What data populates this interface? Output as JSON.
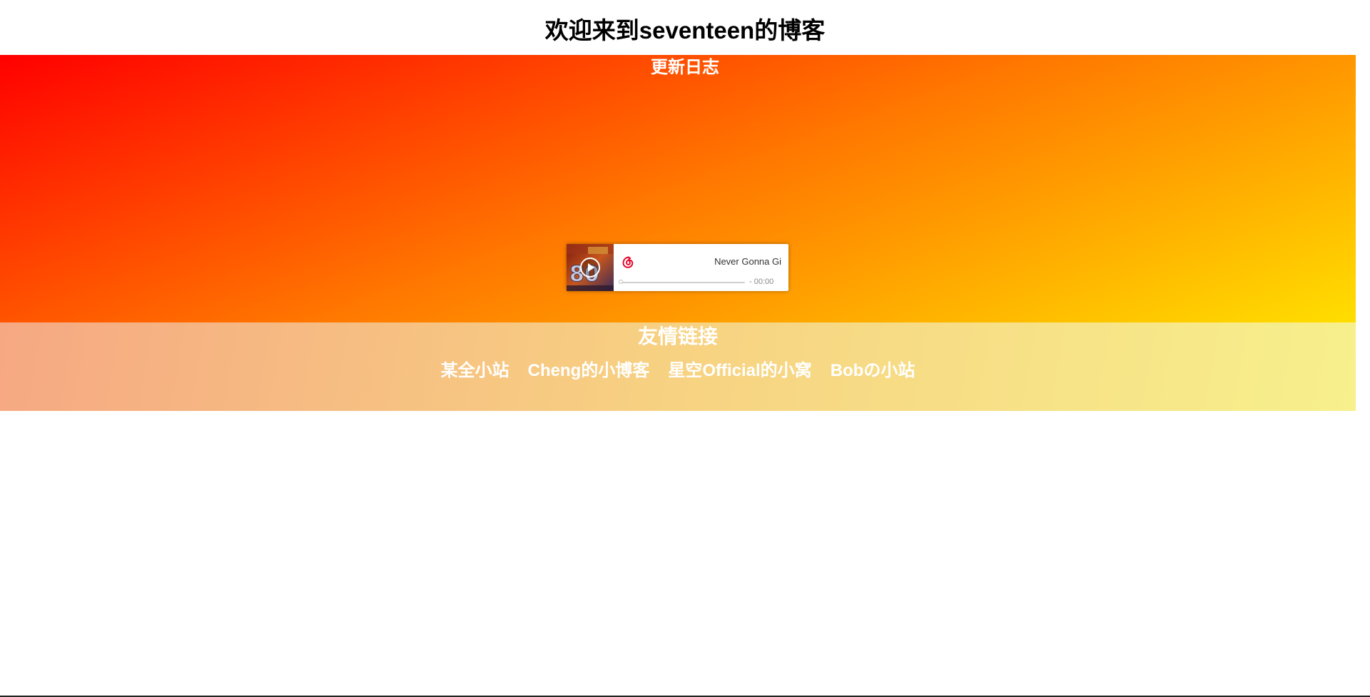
{
  "header": {
    "title": "欢迎来到seventeen的博客"
  },
  "update_log": {
    "title": "更新日志"
  },
  "music_player": {
    "song_title": "Never Gonna Gi",
    "time": "- 00:00",
    "progress": 0,
    "brand_color": "#c20c0c"
  },
  "friends": {
    "title": "友情链接",
    "links": [
      {
        "label": "某全小站"
      },
      {
        "label": "Cheng的小博客"
      },
      {
        "label": "星空Official的小窝"
      },
      {
        "label": "Bobの小站"
      }
    ]
  },
  "colors": {
    "update_gradient": [
      "#ff0000",
      "#ff7700",
      "#ffde00"
    ],
    "friends_gradient": [
      "#f6a882",
      "#f7d282",
      "#f7f08c"
    ]
  }
}
